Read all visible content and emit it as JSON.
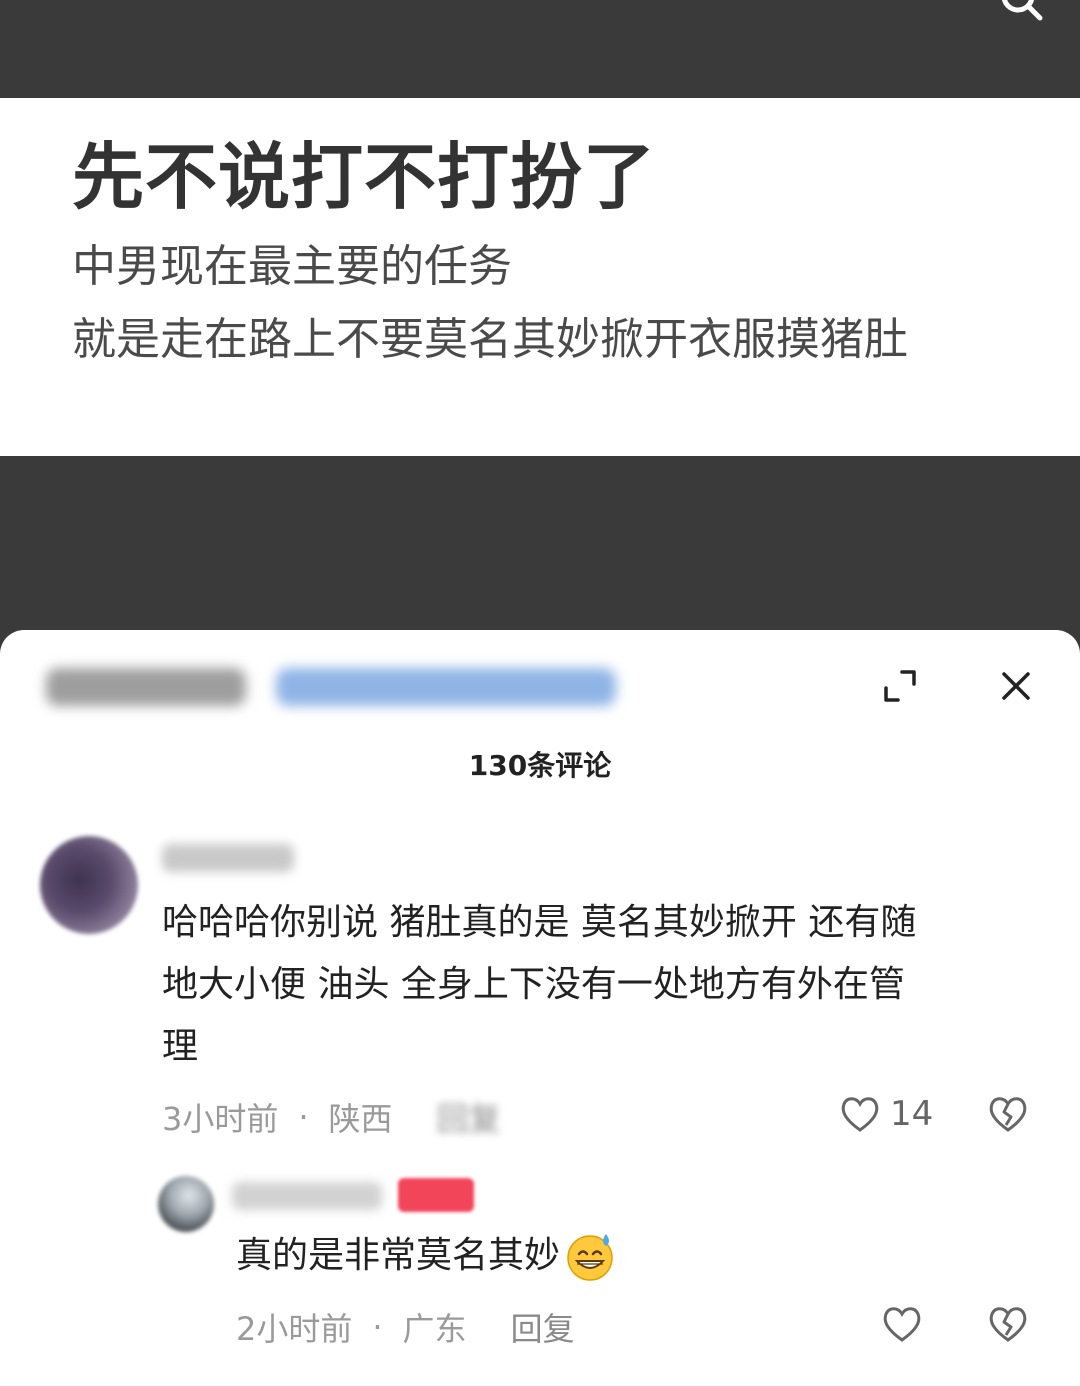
{
  "video": {
    "title": "先不说打不打扮了",
    "line1": "中男现在最主要的任务",
    "line2": "就是走在路上不要莫名其妙掀开衣服摸猪肚"
  },
  "comments_panel": {
    "count_label": "130条评论"
  },
  "comment": {
    "text": "哈哈哈你别说  猪肚真的是  莫名其妙掀开  还有随\n地大小便  油头  全身上下没有一处地方有外在管\n理",
    "time": "3小时前",
    "location": "陕西",
    "reply_label": "回复",
    "likes": "14"
  },
  "reply": {
    "text": "真的是非常莫名其妙",
    "emoji": "grinning-sweat-emoji",
    "time": "2小时前",
    "location": "广东",
    "reply_label": "回复"
  },
  "meta": {
    "separator": "·"
  },
  "icons": {
    "search": "search-icon",
    "expand": "expand-icon",
    "close": "close-icon",
    "like": "heart-icon",
    "dislike": "broken-heart-icon"
  },
  "colors": {
    "background_dark": "#3a3a3a",
    "card": "#ffffff",
    "badge": "#f2455a"
  }
}
